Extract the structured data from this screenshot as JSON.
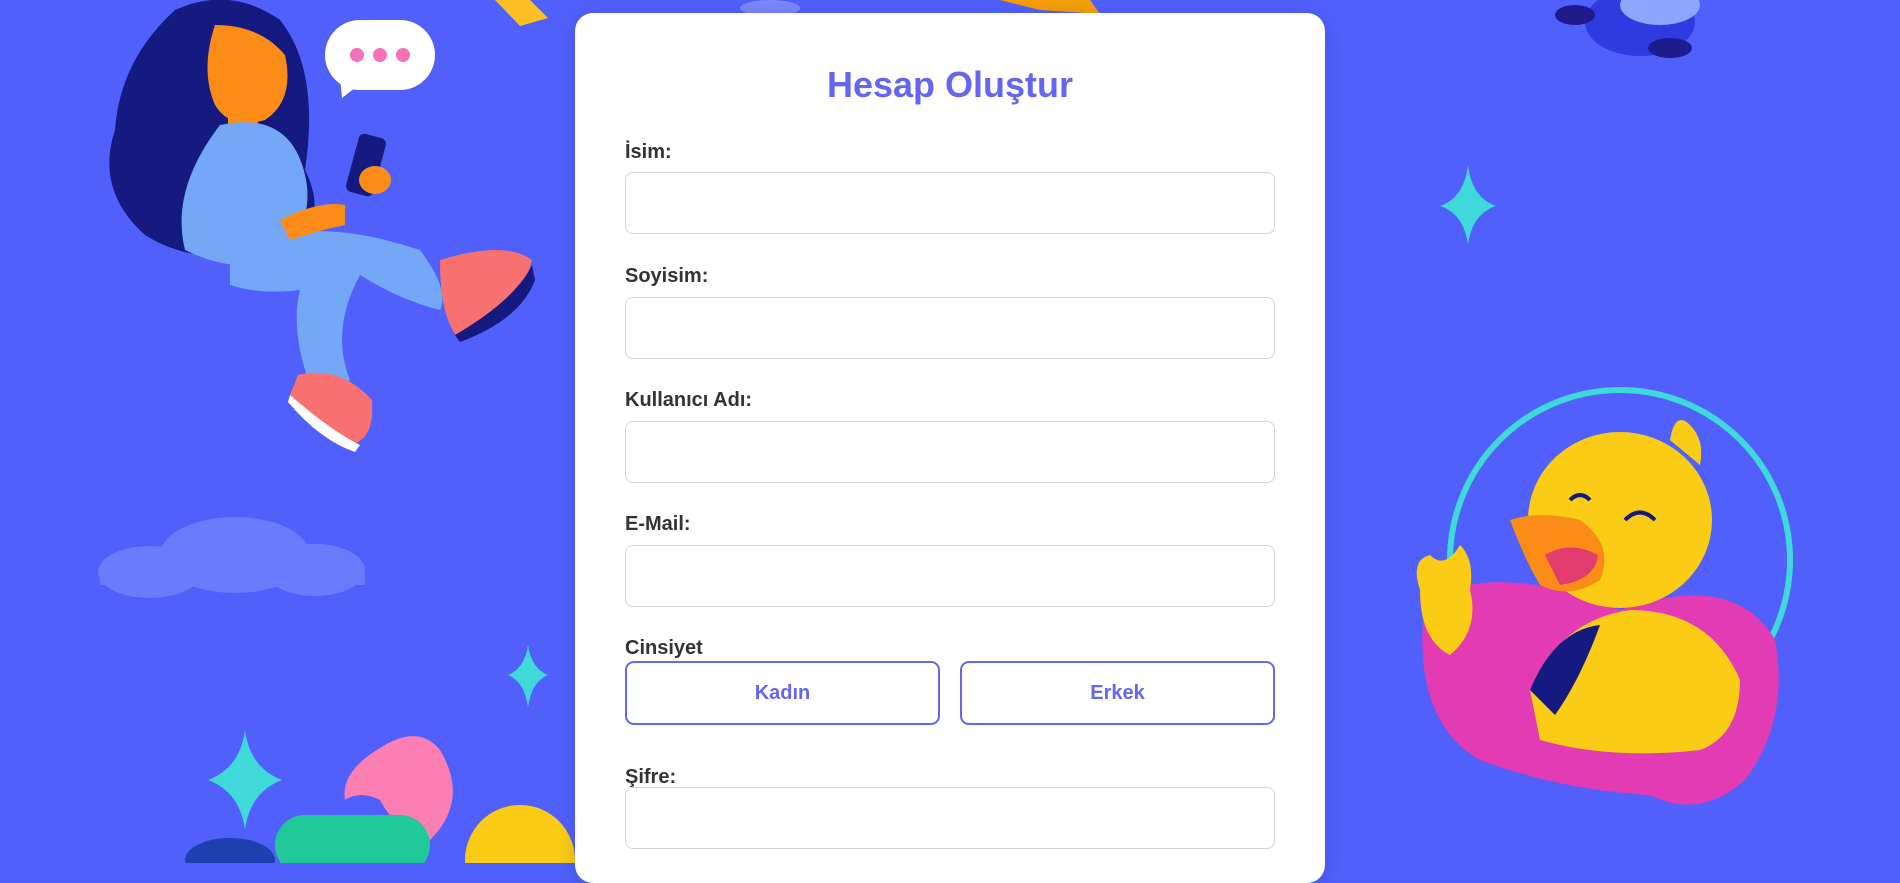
{
  "form": {
    "title": "Hesap Oluştur",
    "fields": [
      {
        "label": "İsim:",
        "value": "",
        "placeholder": ""
      },
      {
        "label": "Soyisim:",
        "value": "",
        "placeholder": ""
      },
      {
        "label": "Kullanıcı Adı:",
        "value": "",
        "placeholder": ""
      },
      {
        "label": "E-Mail:",
        "value": "",
        "placeholder": ""
      }
    ],
    "gender": {
      "label": "Cinsiyet",
      "options": [
        "Kadın",
        "Erkek"
      ]
    },
    "password": {
      "label": "Şifre:",
      "value": "",
      "placeholder": ""
    }
  },
  "colors": {
    "background": "#5160fb",
    "card": "#ffffff",
    "accent": "#6366f1",
    "label_text": "#333333",
    "input_border": "#d1d5db"
  },
  "illustrations": [
    "girl-with-phone-illustration",
    "speech-bubble-icon",
    "duck-with-float-illustration",
    "sparkle-star-icon",
    "cloud-shape",
    "flower-petal-shape",
    "planet-ring-shape",
    "flying-bird-illustration"
  ]
}
